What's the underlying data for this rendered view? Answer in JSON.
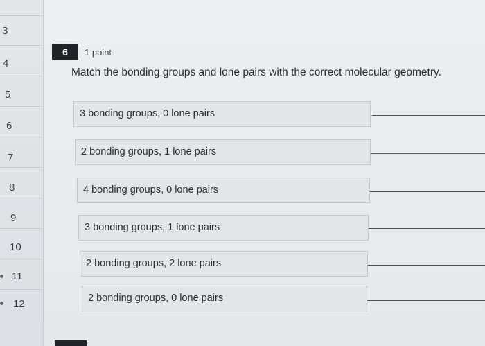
{
  "navigator": {
    "items": [
      {
        "label": "3"
      },
      {
        "label": "4"
      },
      {
        "label": "5"
      },
      {
        "label": "6"
      },
      {
        "label": "7"
      },
      {
        "label": "8"
      },
      {
        "label": "9"
      },
      {
        "label": "10"
      },
      {
        "label": "11"
      },
      {
        "label": "12"
      }
    ]
  },
  "question": {
    "number": "6",
    "points": "1 point",
    "prompt": "Match the bonding groups and lone pairs with the correct molecular geometry.",
    "items": [
      {
        "label": "3 bonding groups, 0 lone pairs"
      },
      {
        "label": "2 bonding groups, 1 lone pairs"
      },
      {
        "label": "4 bonding groups, 0 lone pairs"
      },
      {
        "label": "3 bonding groups, 1 lone pairs"
      },
      {
        "label": "2 bonding groups, 2 lone pairs"
      },
      {
        "label": "2 bonding groups, 0 lone pairs"
      }
    ]
  }
}
